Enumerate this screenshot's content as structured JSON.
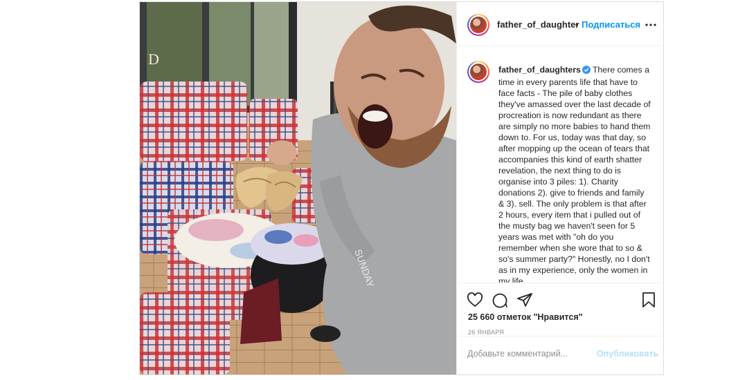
{
  "header": {
    "username": "father_of_daughter",
    "separator": "•",
    "follow_label": "Подписаться",
    "more_icon": "more-horizontal-icon"
  },
  "caption": {
    "username": "father_of_daughters",
    "verified_icon": "verified-badge-icon",
    "text": "There comes a time in every parents life that have to face facts - The pile of baby clothes they've amassed over the last decade of procreation is now redundant as there are simply no more babies to hand them down to. For us, today was that day, so after mopping up the ocean of tears that accompanies this kind of earth shatter revelation, the next thing to do is organise into 3 piles: 1). Charity donations 2). give to friends and family & 3). sell. The only problem is that after 2 hours, every item that i pulled out of the musty bag we haven't seen for 5 years was met with \"oh do you remember when she wore that to so & so's summer party?\" Honestly, no I don't as in my experience, only the women in my life"
  },
  "actions": {
    "like_icon": "heart-icon",
    "comment_icon": "comment-icon",
    "share_icon": "send-icon",
    "save_icon": "bookmark-icon",
    "likes": "25 660 отметок \"Нравится\"",
    "date": "26 ЯНВАРЯ"
  },
  "comment": {
    "placeholder": "Добавьте комментарий...",
    "publish_label": "Опубликовать"
  },
  "colors": {
    "link": "#0095f6",
    "publish_disabled": "#b2dffc",
    "border": "#dbdbdb",
    "verified": "#3897f0"
  }
}
